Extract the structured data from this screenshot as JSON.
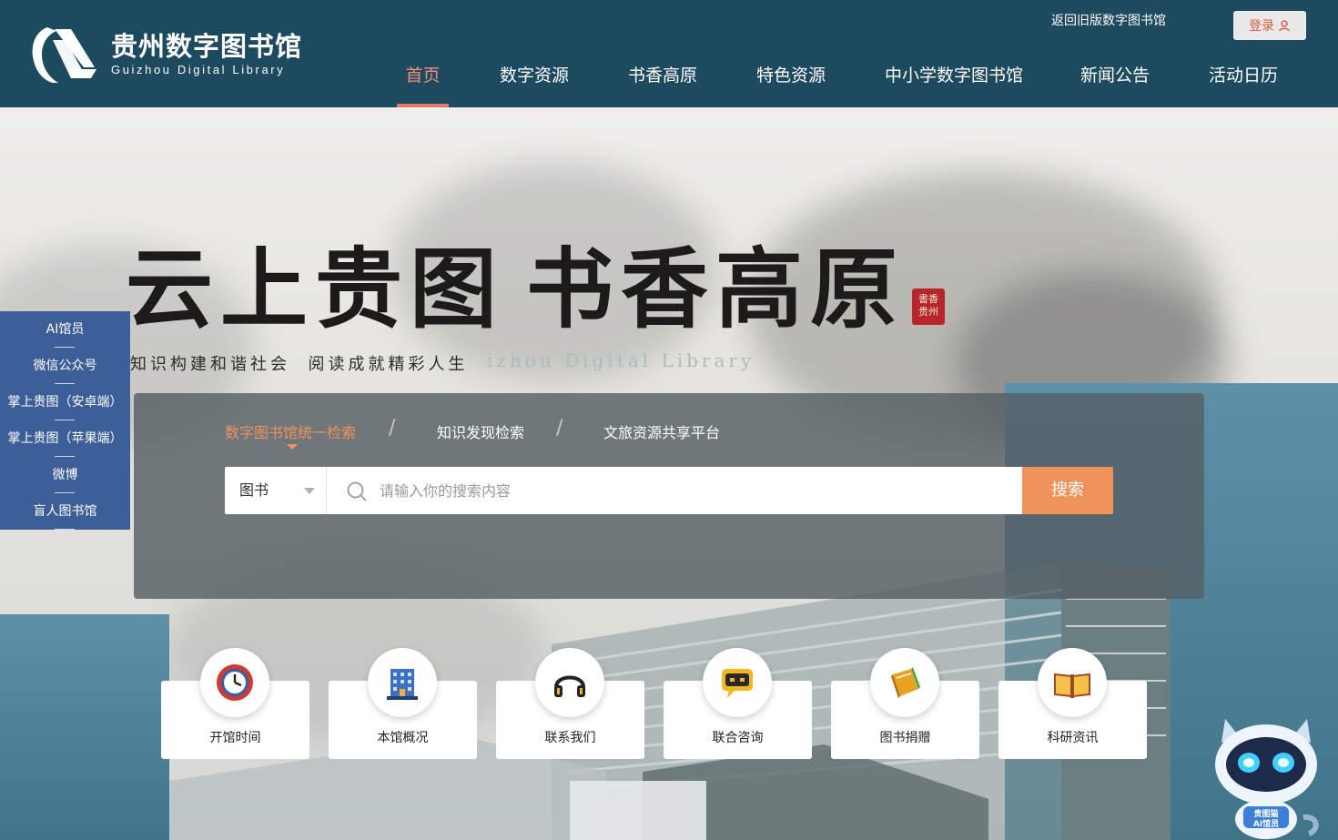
{
  "header": {
    "logo_cn": "贵州数字图书馆",
    "logo_en": "Guizhou Digital Library",
    "old_version_link": "返回旧版数字图书馆",
    "login_label": "登录",
    "nav": [
      {
        "label": "首页",
        "active": true
      },
      {
        "label": "数字资源"
      },
      {
        "label": "书香高原"
      },
      {
        "label": "特色资源"
      },
      {
        "label": "中小学数字图书馆"
      },
      {
        "label": "新闻公告"
      },
      {
        "label": "活动日历"
      }
    ]
  },
  "hero": {
    "slogan_left": "云上贵图",
    "slogan_right": "书香高原",
    "seal_text": "書香贵州",
    "subtitle_left": "知识构建和谐社会",
    "subtitle_right": "阅读成就精彩人生",
    "english_faded": "izhou Digital Library"
  },
  "side_panel": {
    "items": [
      "AI馆员",
      "微信公众号",
      "掌上贵图（安卓端）",
      "掌上贵图（苹果端）",
      "微博",
      "盲人图书馆"
    ]
  },
  "search": {
    "tabs": [
      {
        "label": "数字图书馆统一检索",
        "active": true
      },
      {
        "label": "知识发现检索"
      },
      {
        "label": "文旅资源共享平台"
      }
    ],
    "separator": "/",
    "type_selected": "图书",
    "placeholder": "请输入你的搜索内容",
    "button_label": "搜索"
  },
  "quick_links": [
    {
      "label": "开馆时间",
      "icon": "clock-icon"
    },
    {
      "label": "本馆概况",
      "icon": "building-icon"
    },
    {
      "label": "联系我们",
      "icon": "headphones-icon"
    },
    {
      "label": "联合咨询",
      "icon": "chat-bubble-icon"
    },
    {
      "label": "图书捐赠",
      "icon": "book-icon"
    },
    {
      "label": "科研资讯",
      "icon": "open-book-icon"
    }
  ],
  "robot": {
    "label_line1": "贵图猫",
    "label_line2": "AI馆员"
  },
  "colors": {
    "header_bg": "#1d4a5f",
    "nav_active": "#f08d7e",
    "accent_orange": "#f0935b",
    "side_panel_bg": "#3d5f98"
  }
}
